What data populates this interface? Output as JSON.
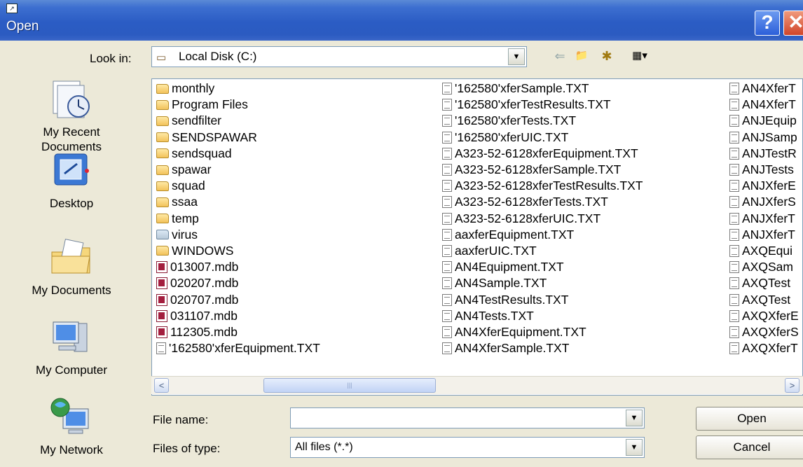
{
  "window": {
    "title": "Open",
    "help_glyph": "?",
    "close_glyph": "✕",
    "sys_glyph": "↗"
  },
  "lookin": {
    "label": "Look in:",
    "value": "Local Disk (C:)",
    "drive_glyph": "▭",
    "dropdown_glyph": "▼"
  },
  "toolbar": {
    "back_glyph": "⇐",
    "up_glyph": "📁",
    "newfolder_glyph": "✱",
    "views_glyph": "▦▾"
  },
  "places": [
    {
      "label1": "My Recent",
      "label2": "Documents",
      "icon": "recent-documents-icon"
    },
    {
      "label1": "Desktop",
      "label2": "",
      "icon": "desktop-icon"
    },
    {
      "label1": "My Documents",
      "label2": "",
      "icon": "my-documents-icon"
    },
    {
      "label1": "My Computer",
      "label2": "",
      "icon": "my-computer-icon"
    },
    {
      "label1": "My Network",
      "label2": "",
      "icon": "my-network-icon"
    }
  ],
  "files": {
    "col1": [
      {
        "name": "monthly",
        "type": "folder"
      },
      {
        "name": "Program Files",
        "type": "folder"
      },
      {
        "name": "sendfilter",
        "type": "folder"
      },
      {
        "name": "SENDSPAWAR",
        "type": "folder"
      },
      {
        "name": "sendsquad",
        "type": "folder"
      },
      {
        "name": "spawar",
        "type": "folder"
      },
      {
        "name": "squad",
        "type": "folder"
      },
      {
        "name": "ssaa",
        "type": "folder"
      },
      {
        "name": "temp",
        "type": "folder"
      },
      {
        "name": "virus",
        "type": "folder-special"
      },
      {
        "name": "WINDOWS",
        "type": "folder"
      },
      {
        "name": "013007.mdb",
        "type": "mdb"
      },
      {
        "name": "020207.mdb",
        "type": "mdb"
      },
      {
        "name": "020707.mdb",
        "type": "mdb"
      },
      {
        "name": "031107.mdb",
        "type": "mdb"
      },
      {
        "name": "112305.mdb",
        "type": "mdb"
      },
      {
        "name": "'162580'xferEquipment.TXT",
        "type": "txt"
      }
    ],
    "col2": [
      {
        "name": "'162580'xferSample.TXT",
        "type": "txt"
      },
      {
        "name": "'162580'xferTestResults.TXT",
        "type": "txt"
      },
      {
        "name": "'162580'xferTests.TXT",
        "type": "txt"
      },
      {
        "name": "'162580'xferUIC.TXT",
        "type": "txt"
      },
      {
        "name": "A323-52-6128xferEquipment.TXT",
        "type": "txt"
      },
      {
        "name": "A323-52-6128xferSample.TXT",
        "type": "txt"
      },
      {
        "name": "A323-52-6128xferTestResults.TXT",
        "type": "txt"
      },
      {
        "name": "A323-52-6128xferTests.TXT",
        "type": "txt"
      },
      {
        "name": "A323-52-6128xferUIC.TXT",
        "type": "txt"
      },
      {
        "name": "aaxferEquipment.TXT",
        "type": "txt"
      },
      {
        "name": "aaxferUIC.TXT",
        "type": "txt"
      },
      {
        "name": "AN4Equipment.TXT",
        "type": "txt"
      },
      {
        "name": "AN4Sample.TXT",
        "type": "txt"
      },
      {
        "name": "AN4TestResults.TXT",
        "type": "txt"
      },
      {
        "name": "AN4Tests.TXT",
        "type": "txt"
      },
      {
        "name": "AN4XferEquipment.TXT",
        "type": "txt"
      },
      {
        "name": "AN4XferSample.TXT",
        "type": "txt"
      }
    ],
    "col3": [
      {
        "name": "AN4XferT",
        "type": "txt"
      },
      {
        "name": "AN4XferT",
        "type": "txt"
      },
      {
        "name": "ANJEquip",
        "type": "txt"
      },
      {
        "name": "ANJSamp",
        "type": "txt"
      },
      {
        "name": "ANJTestR",
        "type": "txt"
      },
      {
        "name": "ANJTests",
        "type": "txt"
      },
      {
        "name": "ANJXferE",
        "type": "txt"
      },
      {
        "name": "ANJXferS",
        "type": "txt"
      },
      {
        "name": "ANJXferT",
        "type": "txt"
      },
      {
        "name": "ANJXferT",
        "type": "txt"
      },
      {
        "name": "AXQEqui",
        "type": "txt"
      },
      {
        "name": "AXQSam",
        "type": "txt"
      },
      {
        "name": "AXQTest",
        "type": "txt"
      },
      {
        "name": "AXQTest",
        "type": "txt"
      },
      {
        "name": "AXQXferE",
        "type": "txt"
      },
      {
        "name": "AXQXferS",
        "type": "txt"
      },
      {
        "name": "AXQXferT",
        "type": "txt"
      }
    ]
  },
  "scroll": {
    "left_glyph": "<",
    "right_glyph": ">",
    "grip": "|||"
  },
  "filename": {
    "label": "File name:",
    "value": "",
    "placeholder": ""
  },
  "filetype": {
    "label": "Files of type:",
    "value": "All files (*.*)"
  },
  "buttons": {
    "open": "Open",
    "cancel": "Cancel"
  }
}
